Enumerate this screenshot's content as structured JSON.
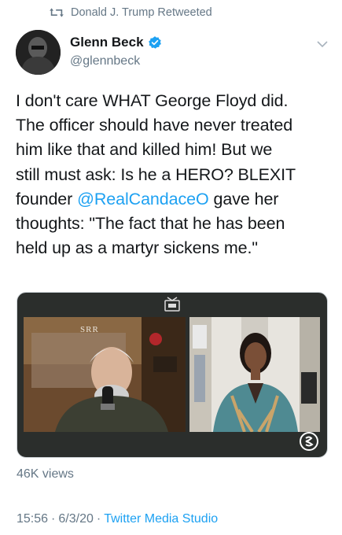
{
  "retweet": {
    "label": "Donald J. Trump Retweeted",
    "icon": "retweet-icon"
  },
  "author": {
    "name": "Glenn Beck",
    "handle": "@glennbeck",
    "verified": true
  },
  "tweet": {
    "line1": "I don't care WHAT George Floyd did.",
    "line2": "The officer should have never treated",
    "line3": "him like that and killed him! But we",
    "line4": "still must ask: Is he a HERO? BLEXIT",
    "line5_before": "founder ",
    "line5_mention": "@RealCandaceO",
    "line5_after": " gave her",
    "line6": "thoughts: \"The fact that he has been",
    "line7": "held up as a martyr sickens me.\""
  },
  "media": {
    "logo_text": "SRR"
  },
  "stats": {
    "views": "46K views"
  },
  "meta": {
    "time": "15:56",
    "separator1": "·",
    "date": "6/3/20",
    "separator2": "·",
    "source": "Twitter Media Studio"
  },
  "colors": {
    "link": "#1da1f2",
    "secondary": "#657786",
    "text": "#14171a"
  }
}
